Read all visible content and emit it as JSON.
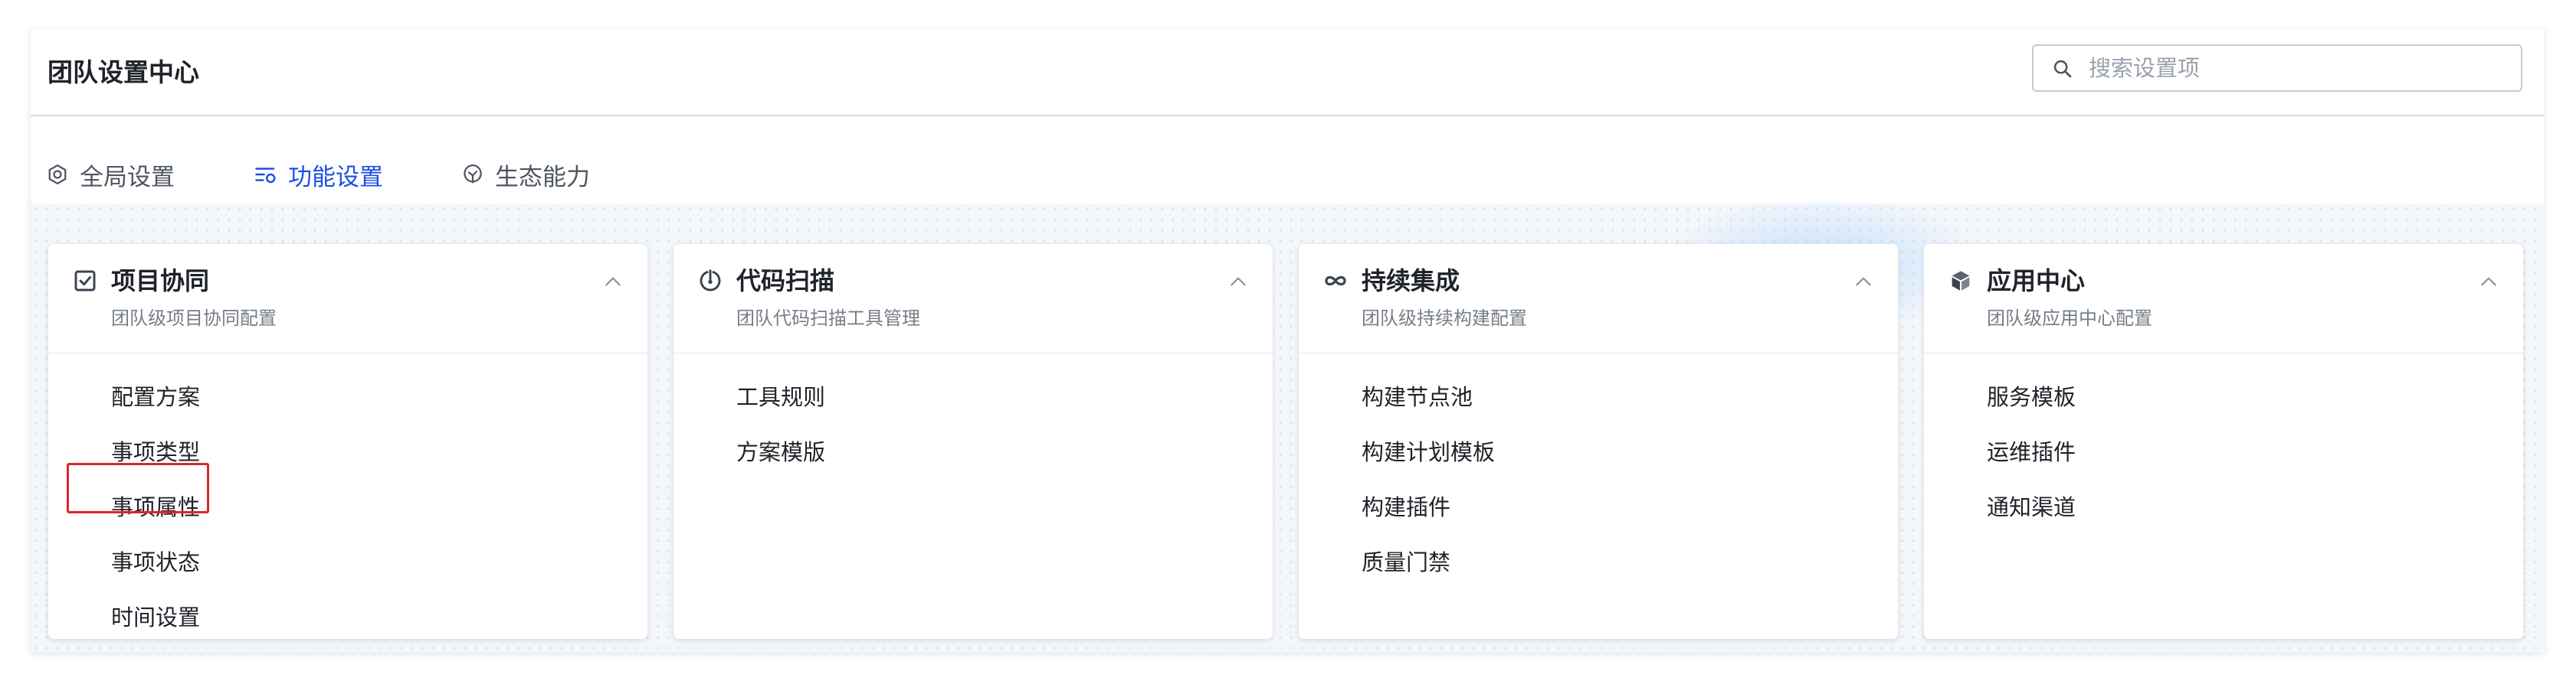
{
  "header": {
    "title": "团队设置中心",
    "search_placeholder": "搜索设置项"
  },
  "tabs": [
    {
      "label": "全局设置",
      "icon": "gear-icon",
      "active": false
    },
    {
      "label": "功能设置",
      "icon": "feature-list-icon",
      "active": true
    },
    {
      "label": "生态能力",
      "icon": "ecosystem-icon",
      "active": false
    }
  ],
  "colors": {
    "accent": "#1c4fe6",
    "highlight": "#e0242c"
  },
  "cards": [
    {
      "title": "项目协同",
      "subtitle": "团队级项目协同配置",
      "icon": "checklist-icon",
      "items": [
        "配置方案",
        "事项类型",
        "事项属性",
        "事项状态",
        "时间设置"
      ]
    },
    {
      "title": "代码扫描",
      "subtitle": "团队代码扫描工具管理",
      "icon": "scan-icon",
      "items": [
        "工具规则",
        "方案模版"
      ]
    },
    {
      "title": "持续集成",
      "subtitle": "团队级持续构建配置",
      "icon": "infinity-icon",
      "items": [
        "构建节点池",
        "构建计划模板",
        "构建插件",
        "质量门禁"
      ]
    },
    {
      "title": "应用中心",
      "subtitle": "团队级应用中心配置",
      "icon": "package-icon",
      "items": [
        "服务模板",
        "运维插件",
        "通知渠道"
      ]
    }
  ]
}
